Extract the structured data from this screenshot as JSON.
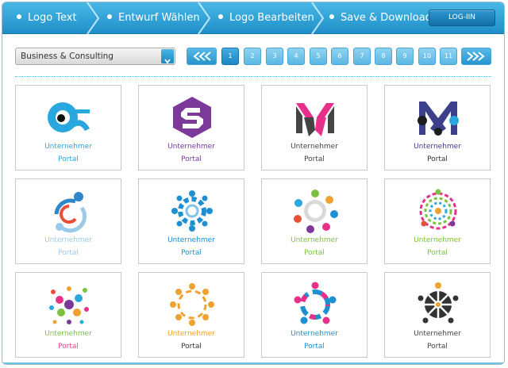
{
  "wizard": {
    "steps": [
      {
        "label": "Logo Text"
      },
      {
        "label": "Entwurf Wählen"
      },
      {
        "label": "Logo Bearbeiten"
      },
      {
        "label": "Save & Download"
      }
    ],
    "login_label": "LOG-IIN"
  },
  "category": {
    "selected": "Business & Consulting"
  },
  "pagination": {
    "prev_icon": "double-chevron-left-icon",
    "next_icon": "double-chevron-right-icon",
    "pages": [
      "1",
      "2",
      "3",
      "4",
      "5",
      "6",
      "7",
      "8",
      "9",
      "10",
      "11"
    ],
    "current": "1"
  },
  "colors": {
    "header": "#2a9ed8",
    "accent": "#1b86c2",
    "page_button": "#7cc9ec"
  },
  "logos": [
    {
      "icon": "infinity-swirl-icon",
      "line1": "Unternehmer",
      "line2": "Portal",
      "color1": "#29a8e0",
      "color2": "#29a8e0"
    },
    {
      "icon": "hexagon-s-icon",
      "line1": "Unternehmer",
      "line2": "Portal",
      "color1": "#7b3a99",
      "color2": "#7b3a99"
    },
    {
      "icon": "geometric-m-icon",
      "line1": "Unternehmer",
      "line2": "Portal",
      "color1": "#444444",
      "color2": "#444444"
    },
    {
      "icon": "crossed-m-icon",
      "line1": "Unternehmer",
      "line2": "Portal",
      "color1": "#3b3f8c",
      "color2": "#333333"
    },
    {
      "icon": "people-circle-icon",
      "line1": "Unternehmer",
      "line2": "Portal",
      "color1": "#9bc9e8",
      "color2": "#9bc9e8"
    },
    {
      "icon": "blue-people-ring-icon",
      "line1": "Unternehmer",
      "line2": "Portal",
      "color1": "#1e8fd0",
      "color2": "#1e8fd0"
    },
    {
      "icon": "colorful-people-ring-icon",
      "line1": "Unternehmer",
      "line2": "Portal",
      "color1": "#7cc241",
      "color2": "#7cc241"
    },
    {
      "icon": "rainbow-rings-icon",
      "line1": "Unternehmer",
      "line2": "Portal",
      "color1": "#7cc241",
      "color2": "#7cc241"
    },
    {
      "icon": "burst-dots-icon",
      "line1": "Unternehmer",
      "line2": "Portal",
      "color1": "#7cc241",
      "color2": "#e0428b"
    },
    {
      "icon": "orange-people-ring-icon",
      "line1": "Unternehmer",
      "line2": "Portal",
      "color1": "#f0a230",
      "color2": "#333333"
    },
    {
      "icon": "teamwork-ring-icon",
      "line1": "Unternehmer",
      "line2": "Portal",
      "color1": "#1e8fd0",
      "color2": "#1e8fd0"
    },
    {
      "icon": "dark-people-wheel-icon",
      "line1": "Unternehmer",
      "line2": "Portal",
      "color1": "#444444",
      "color2": "#444444"
    }
  ]
}
